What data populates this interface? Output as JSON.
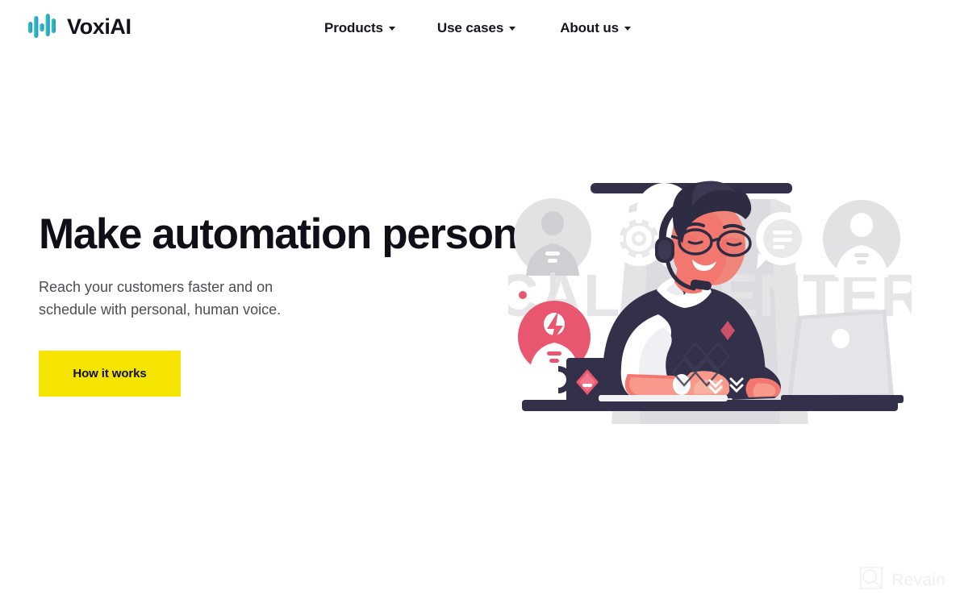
{
  "brand": {
    "name": "VoxiAI",
    "logo_icon": "sound-bars-icon",
    "logo_colors": [
      "#2ecc8f",
      "#25c79a",
      "#23b9c7",
      "#2f9fe0",
      "#3a86f0"
    ]
  },
  "nav": {
    "items": [
      {
        "label": "Products",
        "caret_icon": "chevron-down-icon"
      },
      {
        "label": "Use cases",
        "caret_icon": "chevron-down-icon"
      },
      {
        "label": "About us",
        "caret_icon": "chevron-down-icon"
      }
    ]
  },
  "hero": {
    "headline": "Make automation personal",
    "subhead": "Reach your customers faster and on schedule with personal, human voice.",
    "cta_label": "How it works",
    "cta_color": "#f5e400",
    "headline_color": "#100f18",
    "subhead_color": "#4c4c54"
  },
  "illustration": {
    "name": "call-center-agent-illustration",
    "background_text": "CALL CENTER",
    "elements": [
      "ceiling-light-bar",
      "light-cone",
      "avatar-circle-left",
      "gear-speech-bubble",
      "message-speech-bubble",
      "avatar-circle-right",
      "lightning-badge",
      "coffee-mug",
      "agent-with-headset",
      "laptop",
      "desk-bar"
    ],
    "colors": {
      "dark": "#2e2c42",
      "skin": "#f2776f",
      "skin_light": "#f79a8c",
      "accent_pink": "#e8566f",
      "grey_bg": "#d6d6d9",
      "grey_light": "#ebebed",
      "white": "#ffffff"
    }
  },
  "watermark": {
    "label": "Revain",
    "icon": "magnifier-square-icon"
  }
}
